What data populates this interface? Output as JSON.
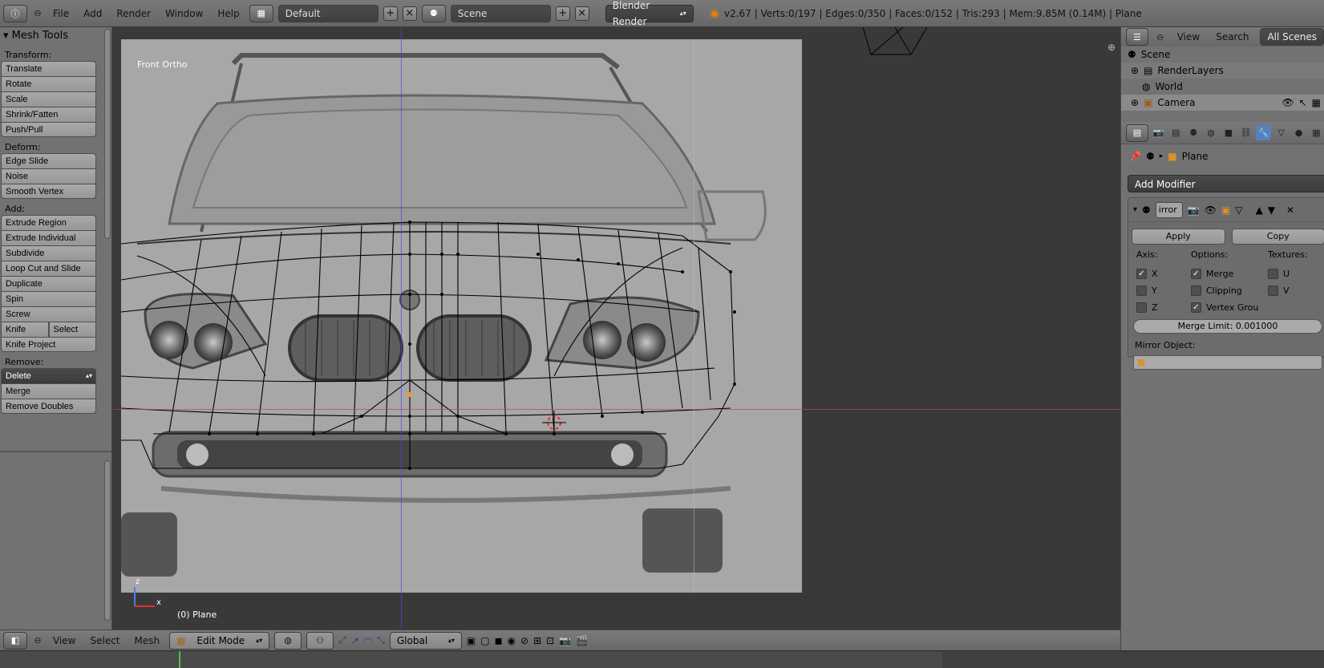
{
  "topbar": {
    "menus": [
      "File",
      "Add",
      "Render",
      "Window",
      "Help"
    ],
    "layout": "Default",
    "scene": "Scene",
    "engine": "Blender Render",
    "stats": "v2.67 | Verts:0/197 | Edges:0/350 | Faces:0/152 | Tris:293 | Mem:9.85M (0.14M) | Plane"
  },
  "toolshelf": {
    "title": "Mesh Tools",
    "transform_label": "Transform:",
    "transform": [
      "Translate",
      "Rotate",
      "Scale",
      "Shrink/Fatten",
      "Push/Pull"
    ],
    "deform_label": "Deform:",
    "deform": [
      "Edge Slide",
      "Noise",
      "Smooth Vertex"
    ],
    "add_label": "Add:",
    "add": [
      "Extrude Region",
      "Extrude Individual",
      "Subdivide",
      "Loop Cut and Slide",
      "Duplicate",
      "Spin",
      "Screw"
    ],
    "knife": "Knife",
    "select": "Select",
    "knife_project": "Knife Project",
    "remove_label": "Remove:",
    "delete": "Delete",
    "merge": "Merge",
    "remove_doubles": "Remove Doubles"
  },
  "viewport": {
    "view_label": "Front Ortho",
    "object_label": "(0) Plane",
    "axis_z": "z",
    "axis_x": "x"
  },
  "bottombar": {
    "menus": [
      "View",
      "Select",
      "Mesh"
    ],
    "mode": "Edit Mode",
    "orientation": "Global"
  },
  "outliner": {
    "menus": [
      "View",
      "Search"
    ],
    "scenes": "All Scenes",
    "rows": [
      "Scene",
      "RenderLayers",
      "World",
      "Camera"
    ]
  },
  "properties": {
    "crumb": "Plane",
    "add_modifier": "Add Modifier",
    "modifier_name": "irror",
    "apply": "Apply",
    "copy": "Copy",
    "axis_label": "Axis:",
    "options_label": "Options:",
    "textures_label": "Textures:",
    "axis": [
      "X",
      "Y",
      "Z"
    ],
    "options": [
      "Merge",
      "Clipping",
      "Vertex Grou"
    ],
    "textures": [
      "U",
      "V"
    ],
    "merge_limit": "Merge Limit: 0.001000",
    "mirror_object": "Mirror Object:"
  },
  "colors": {
    "panel": "#727272",
    "viewport": "#393939",
    "active_tab": "#5680c2",
    "timeline_cursor": "#52c13a"
  }
}
